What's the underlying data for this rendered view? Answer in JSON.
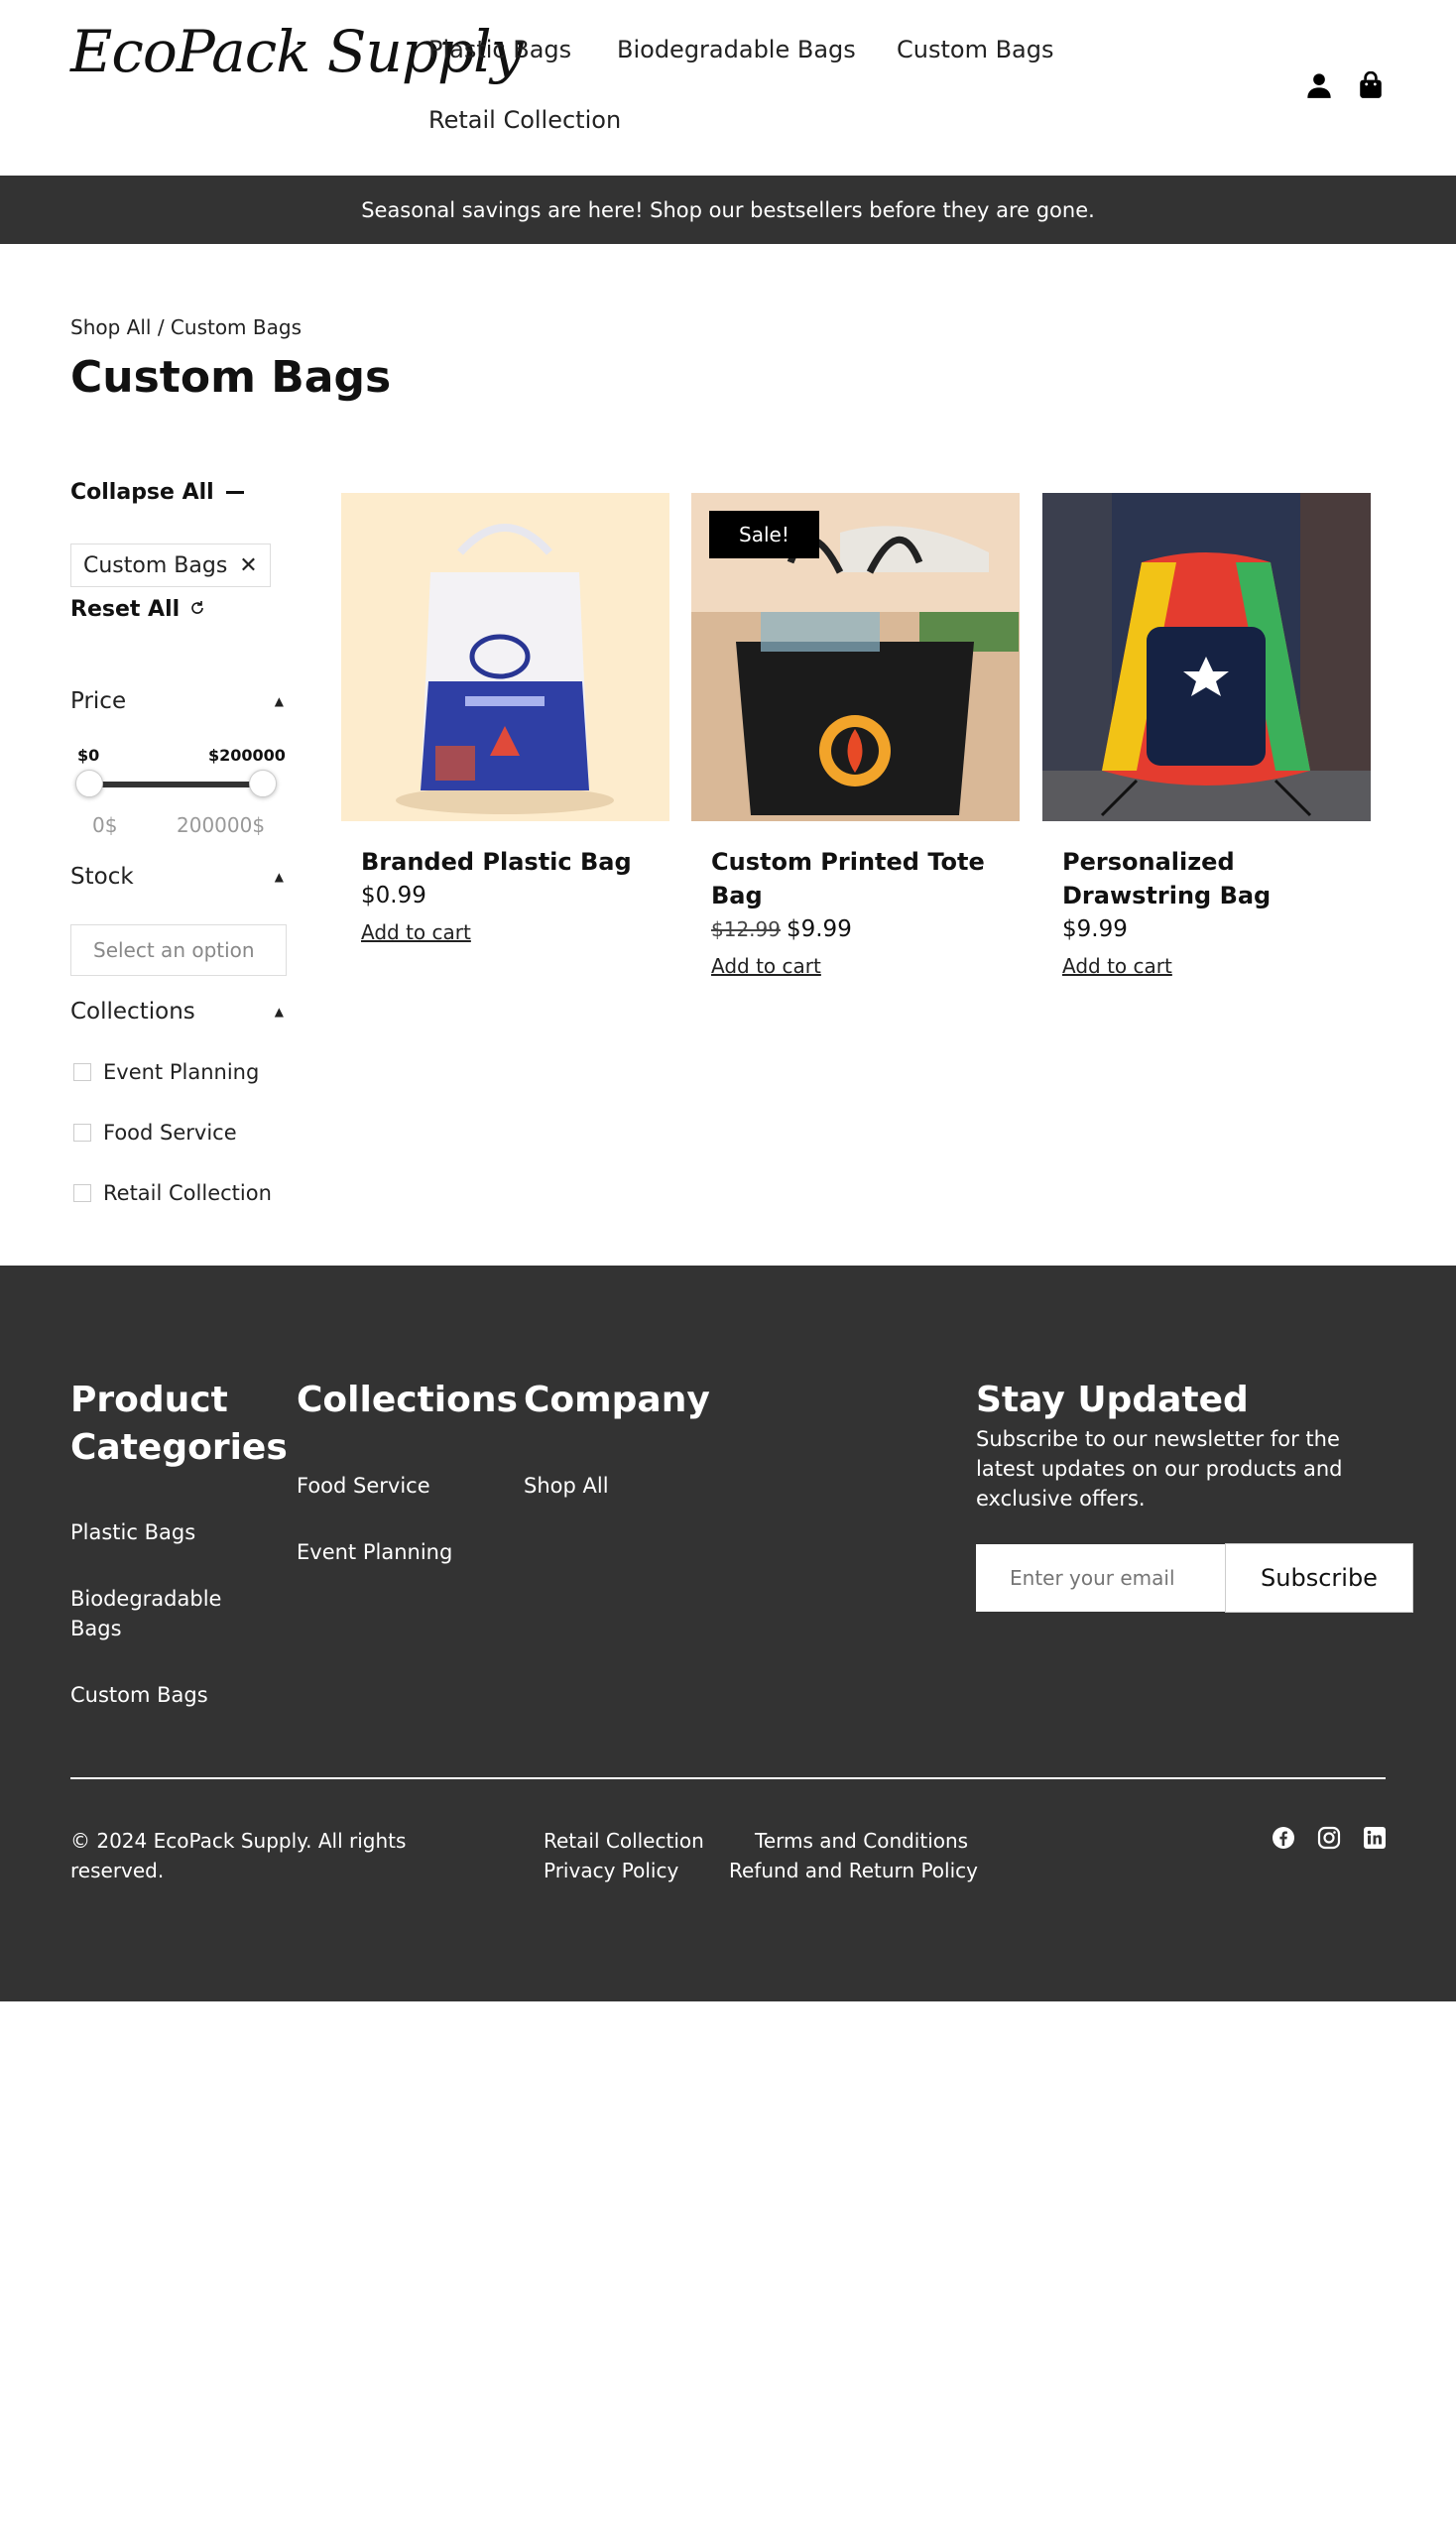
{
  "brand": {
    "logo_text": "EcoPack Supply"
  },
  "nav": {
    "items": [
      {
        "label": "Plastic Bags"
      },
      {
        "label": "Biodegradable Bags"
      },
      {
        "label": "Custom Bags"
      },
      {
        "label": "Retail Collection"
      }
    ],
    "icons": [
      "user-icon",
      "shopping-bag-icon"
    ]
  },
  "promo": {
    "text": "Seasonal savings are here! Shop our bestsellers before they are gone."
  },
  "breadcrumb": {
    "root": "Shop All",
    "separator": " / ",
    "current": "Custom Bags"
  },
  "page": {
    "title": "Custom Bags"
  },
  "filters": {
    "collapse_all": "Collapse All",
    "active_chip": "Custom Bags",
    "reset_all": "Reset All",
    "price": {
      "title": "Price",
      "min_value": "$0",
      "max_value": "$200000",
      "min_label": "0$",
      "max_label": "200000$"
    },
    "stock": {
      "title": "Stock",
      "placeholder": "Select an option"
    },
    "collections": {
      "title": "Collections",
      "options": [
        "Event Planning",
        "Food Service",
        "Retail Collection"
      ]
    }
  },
  "products": [
    {
      "name": "Branded Plastic Bag",
      "old_price": "",
      "price": "$0.99",
      "cta": "Add to cart",
      "badge": ""
    },
    {
      "name": "Custom Printed Tote Bag",
      "old_price": "$12.99",
      "price": "$9.99",
      "cta": "Add to cart",
      "badge": "Sale!"
    },
    {
      "name": "Personalized Drawstring Bag",
      "old_price": "",
      "price": "$9.99",
      "cta": "Add to cart",
      "badge": ""
    }
  ],
  "footer": {
    "product_categories": {
      "title": "Product Categories",
      "links": [
        "Plastic Bags",
        "Biodegradable Bags",
        "Custom Bags"
      ]
    },
    "collections": {
      "title": "Collections",
      "links": [
        "Food Service",
        "Event Planning"
      ]
    },
    "company": {
      "title": "Company",
      "links": [
        "Shop All"
      ]
    },
    "newsletter": {
      "title": "Stay Updated",
      "text": "Subscribe to our newsletter for the latest updates on our products and exclusive offers.",
      "placeholder": "Enter your email",
      "button": "Subscribe"
    },
    "copyright": "© 2024 EcoPack Supply. All rights reserved.",
    "legal_links": [
      "Retail Collection",
      "Terms and Conditions",
      "Privacy Policy",
      "Refund and Return Policy"
    ],
    "social": [
      "facebook-icon",
      "instagram-icon",
      "linkedin-icon"
    ]
  },
  "colors": {
    "dark": "#333333",
    "text": "#111111",
    "white": "#ffffff"
  }
}
